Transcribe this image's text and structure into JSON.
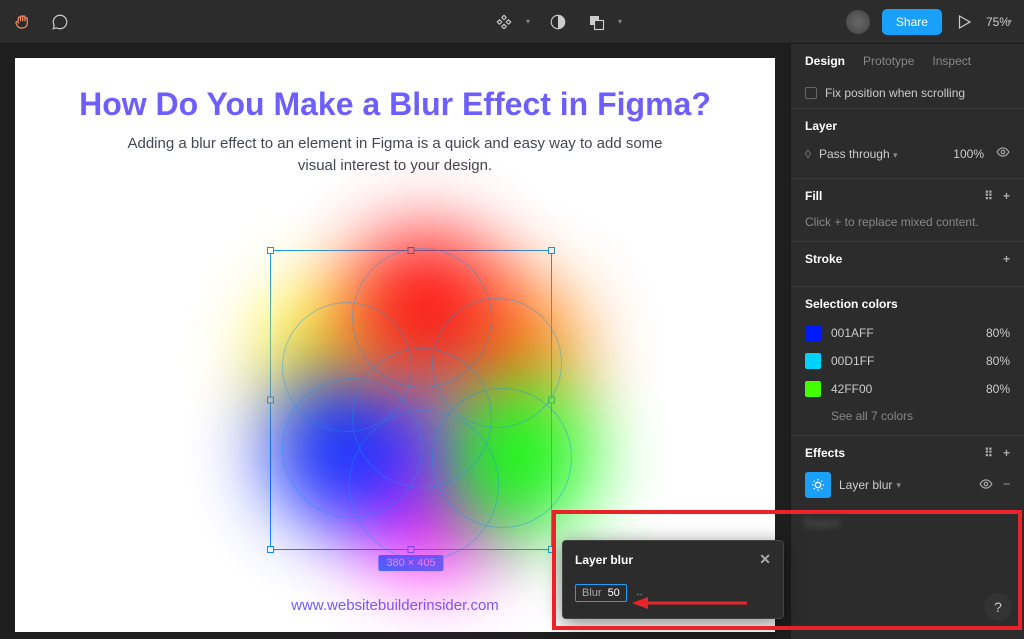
{
  "toolbar": {
    "share": "Share",
    "zoom": "75%"
  },
  "canvas": {
    "title": "How Do You Make a Blur Effect in Figma?",
    "subtitle": "Adding a blur effect to an element in Figma is a quick and easy way to add some visual interest to your design.",
    "dimensions": "380 × 405",
    "url": "www.websitebuilderinsider.com"
  },
  "panel": {
    "tabs": {
      "design": "Design",
      "prototype": "Prototype",
      "inspect": "Inspect"
    },
    "fix_position": "Fix position when scrolling",
    "layer": {
      "header": "Layer",
      "blend": "Pass through",
      "opacity": "100%"
    },
    "fill": {
      "header": "Fill",
      "mix": "Click + to replace mixed content."
    },
    "stroke": {
      "header": "Stroke"
    },
    "selColors": {
      "header": "Selection colors",
      "items": [
        {
          "hex": "001AFF",
          "pct": "80%",
          "color": "#001AFF"
        },
        {
          "hex": "00D1FF",
          "pct": "80%",
          "color": "#00D1FF"
        },
        {
          "hex": "42FF00",
          "pct": "80%",
          "color": "#42FF00"
        }
      ],
      "see_all": "See all 7 colors"
    },
    "effects": {
      "header": "Effects",
      "name": "Layer blur"
    }
  },
  "popup": {
    "title": "Layer blur",
    "blur_label": "Blur",
    "blur_value": "50"
  },
  "help": "?"
}
